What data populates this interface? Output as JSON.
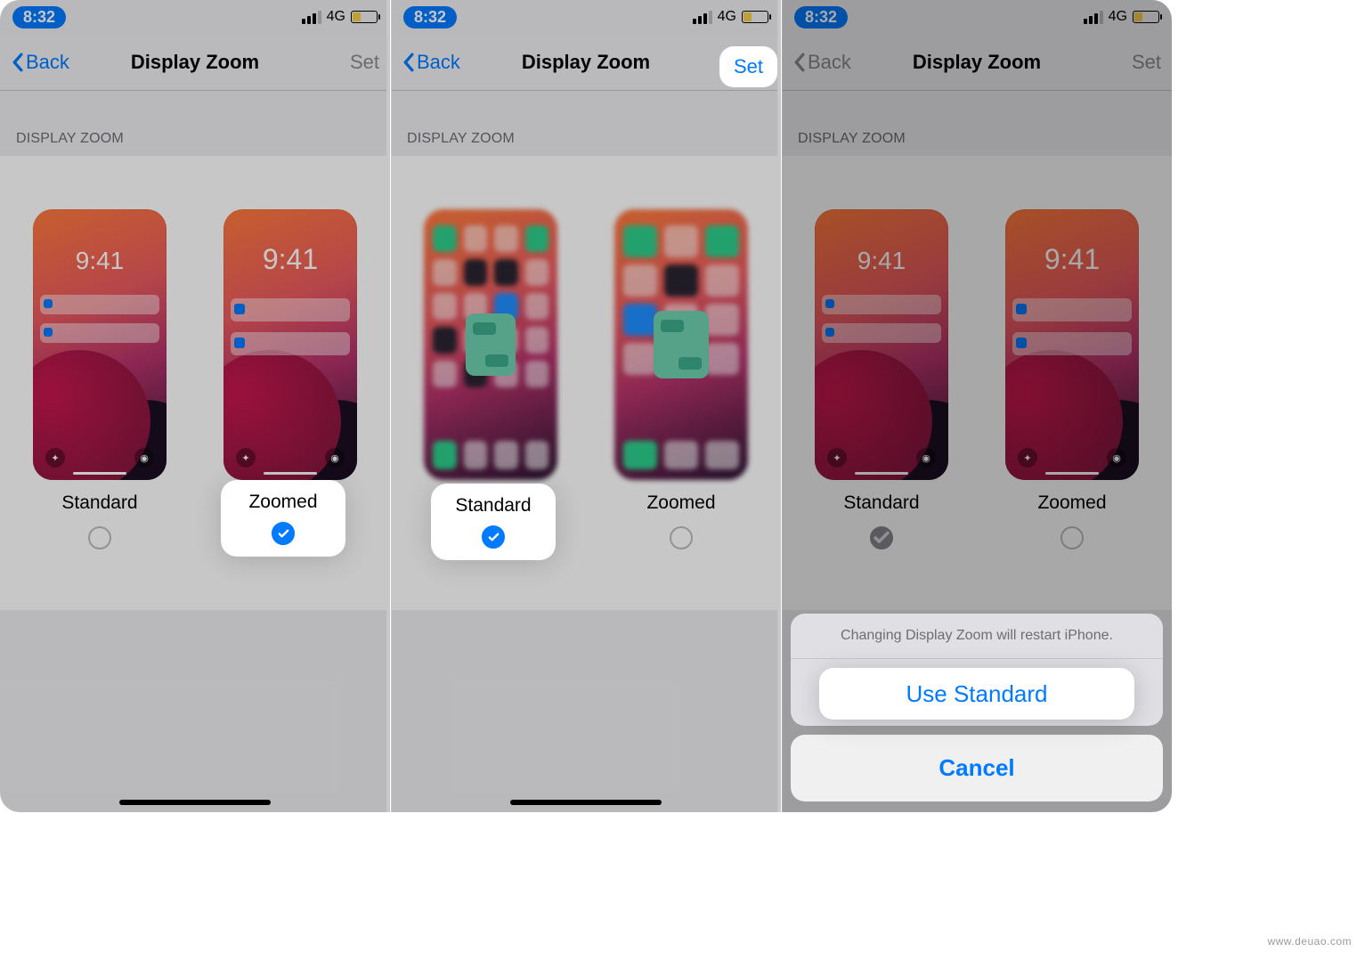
{
  "status": {
    "time": "8:32",
    "network": "4G"
  },
  "nav": {
    "back": "Back",
    "title": "Display Zoom",
    "set": "Set"
  },
  "section": {
    "label": "DISPLAY ZOOM"
  },
  "thumb": {
    "clock": "9:41"
  },
  "options": {
    "standard": "Standard",
    "zoomed": "Zoomed"
  },
  "sheet": {
    "message": "Changing Display Zoom will restart iPhone.",
    "use_standard": "Use Standard",
    "cancel": "Cancel"
  },
  "watermark": "www.deuao.com"
}
